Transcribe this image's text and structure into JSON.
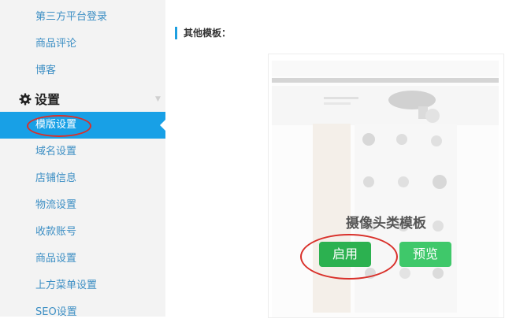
{
  "sidebar": {
    "items_top": [
      {
        "label": "第三方平台登录"
      },
      {
        "label": "商品评论"
      },
      {
        "label": "博客"
      }
    ],
    "section": {
      "label": "设置",
      "icon": "gear-icon"
    },
    "active_item": {
      "label": "模版设置"
    },
    "items_bottom": [
      {
        "label": "域名设置"
      },
      {
        "label": "店铺信息"
      },
      {
        "label": "物流设置"
      },
      {
        "label": "收款账号"
      },
      {
        "label": "商品设置"
      },
      {
        "label": "上方菜单设置"
      },
      {
        "label": "SEO设置"
      }
    ]
  },
  "main": {
    "heading": "其他模板：",
    "template": {
      "name": "摄像头类模板",
      "enable_label": "启用",
      "preview_label": "预览"
    }
  },
  "colors": {
    "accent": "#18a0e6",
    "enable": "#2cb150",
    "preview": "#3fc86a",
    "annotation": "#d9302a"
  }
}
